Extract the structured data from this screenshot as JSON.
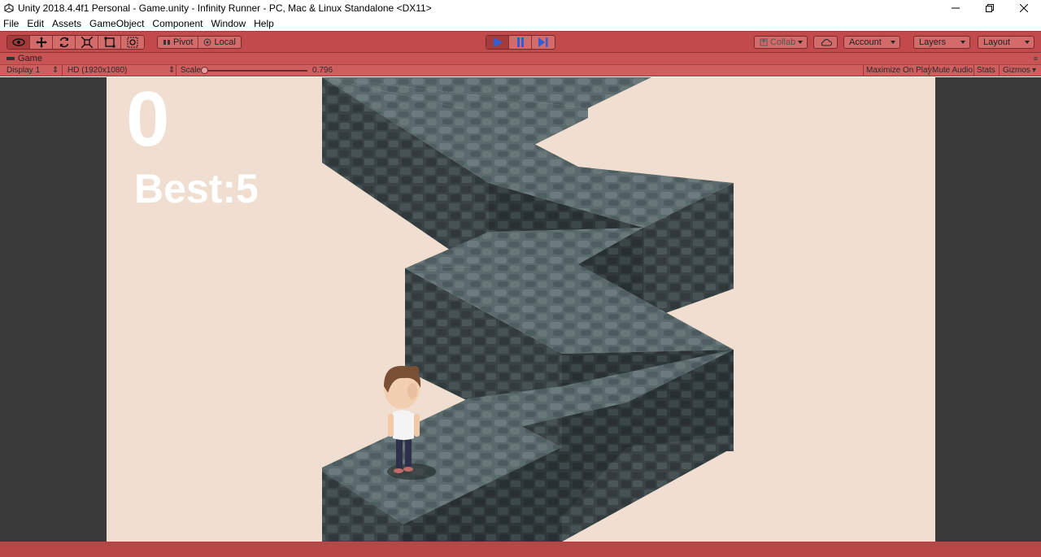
{
  "window": {
    "title": "Unity 2018.4.4f1 Personal - Game.unity - Infinity Runner - PC, Mac & Linux Standalone <DX11>"
  },
  "menu": {
    "items": [
      "File",
      "Edit",
      "Assets",
      "GameObject",
      "Component",
      "Window",
      "Help"
    ]
  },
  "toolbar": {
    "tools": [
      "hand-icon",
      "move-icon",
      "rotate-icon",
      "scale-icon",
      "rect-icon",
      "transform-icon"
    ],
    "pivot_label": "Pivot",
    "local_label": "Local",
    "collab_label": "Collab",
    "account_label": "Account",
    "layers_label": "Layers",
    "layout_label": "Layout"
  },
  "game_tab": {
    "label": "Game",
    "display": "Display 1",
    "resolution": "HD (1920x1080)",
    "scale_label": "Scale",
    "scale_value": "0.796",
    "maximize_label": "Maximize On Play",
    "mute_label": "Mute Audio",
    "stats_label": "Stats",
    "gizmos_label": "Gizmos"
  },
  "game": {
    "score": "0",
    "best": "Best:5"
  },
  "colors": {
    "play_mode_tint": "#c24a4a",
    "viewport_bg": "#f0dfd0",
    "stone_top": "#5a6a6c",
    "stone_side": "#3c4648",
    "play_icon": "#2f5fd8"
  }
}
